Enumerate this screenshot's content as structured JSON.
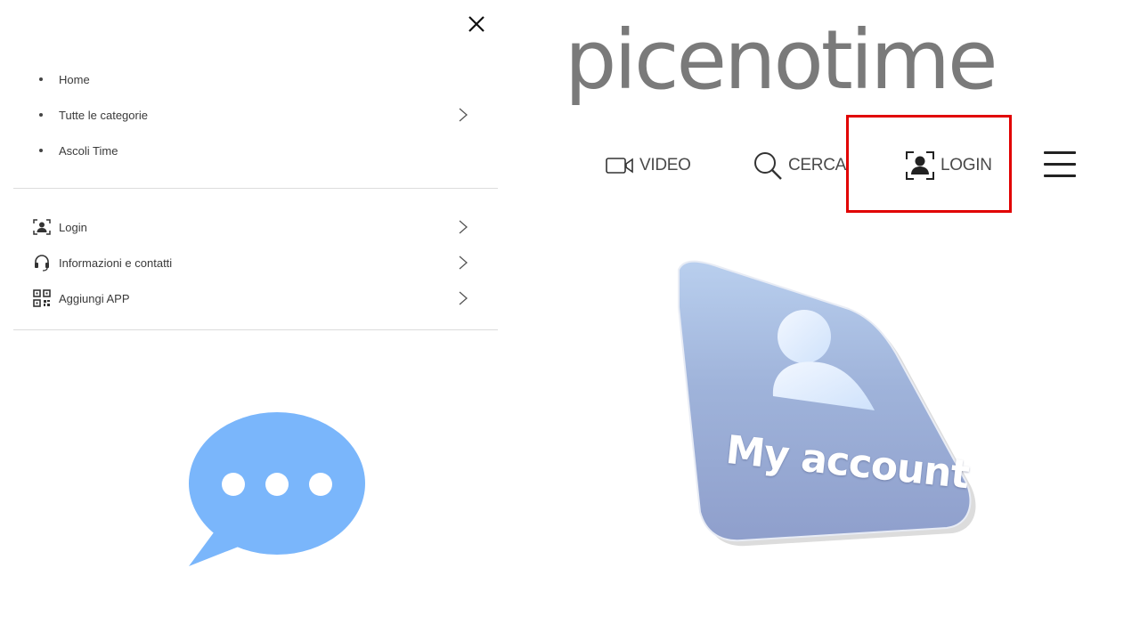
{
  "drawer": {
    "primary_items": [
      {
        "label": "Home"
      },
      {
        "label": "Tutte le categorie",
        "has_submenu": true
      },
      {
        "label": "Ascoli Time"
      }
    ],
    "secondary_items": [
      {
        "label": "Login",
        "icon": "user-frame-icon",
        "has_submenu": true
      },
      {
        "label": "Informazioni e contatti",
        "icon": "headset-icon",
        "has_submenu": true
      },
      {
        "label": "Aggiungi APP",
        "icon": "qr-code-icon",
        "has_submenu": true
      }
    ]
  },
  "header": {
    "logo_text": "picenotime",
    "nav": {
      "video_label": "VIDEO",
      "search_label": "CERCA",
      "login_label": "LOGIN"
    }
  },
  "account_card": {
    "text": "My account"
  },
  "colors": {
    "highlight": "#e10000",
    "logo": "#7a7a7a",
    "chat_bubble": "#7ab6fb",
    "account_card": "#93a4cf"
  }
}
